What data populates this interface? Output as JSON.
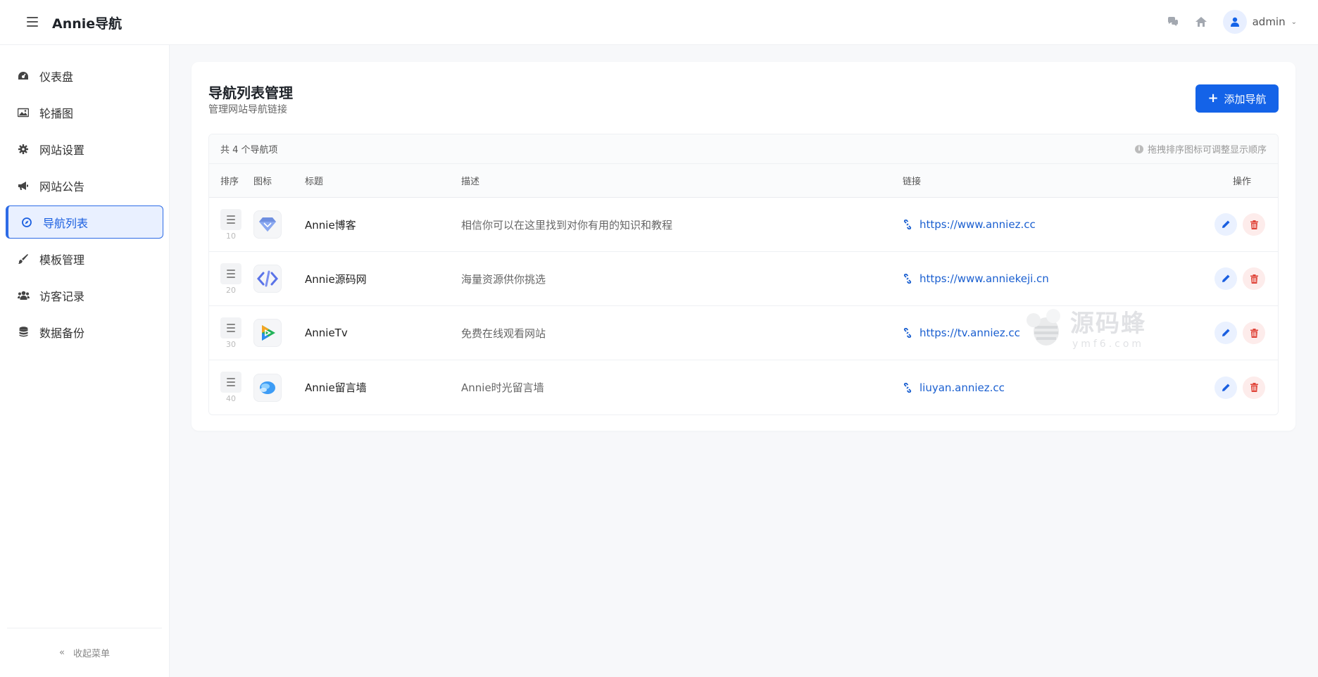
{
  "header": {
    "brand": "Annie导航",
    "username": "admin"
  },
  "sidebar": {
    "items": [
      {
        "label": "仪表盘",
        "icon": "dashboard-icon",
        "active": false
      },
      {
        "label": "轮播图",
        "icon": "image-icon",
        "active": false
      },
      {
        "label": "网站设置",
        "icon": "gear-icon",
        "active": false
      },
      {
        "label": "网站公告",
        "icon": "megaphone-icon",
        "active": false
      },
      {
        "label": "导航列表",
        "icon": "compass-icon",
        "active": true
      },
      {
        "label": "模板管理",
        "icon": "brush-icon",
        "active": false
      },
      {
        "label": "访客记录",
        "icon": "users-icon",
        "active": false
      },
      {
        "label": "数据备份",
        "icon": "database-icon",
        "active": false
      }
    ],
    "collapse_label": "收起菜单"
  },
  "main": {
    "title": "导航列表管理",
    "subtitle": "管理网站导航链接",
    "add_button": "添加导航",
    "count_text": "共 4 个导航项",
    "hint": "拖拽排序图标可调整显示顺序",
    "columns": [
      "排序",
      "图标",
      "标题",
      "描述",
      "链接",
      "操作"
    ],
    "rows": [
      {
        "sort": "10",
        "title": "Annie博客",
        "desc": "相信你可以在这里找到对你有用的知识和教程",
        "link": "https://www.anniez.cc",
        "icon": "diamond-icon"
      },
      {
        "sort": "20",
        "title": "Annie源码网",
        "desc": "海量资源供你挑选",
        "link": "https://www.anniekeji.cn",
        "icon": "code-icon"
      },
      {
        "sort": "30",
        "title": "AnnieTv",
        "desc": "免费在线观看网站",
        "link": "https://tv.anniez.cc",
        "icon": "play-icon"
      },
      {
        "sort": "40",
        "title": "Annie留言墙",
        "desc": "Annie时光留言墙",
        "link": "liuyan.anniez.cc",
        "icon": "bubble-icon"
      }
    ]
  },
  "watermark": {
    "text": "源码蜂",
    "sub": "ymf6.com"
  },
  "colors": {
    "primary": "#1463e8",
    "danger": "#e0453a",
    "link": "#1a5fd0"
  }
}
